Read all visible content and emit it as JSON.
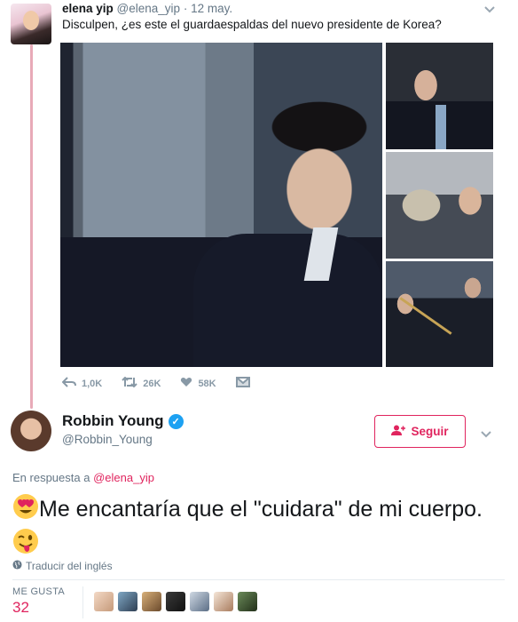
{
  "tweet1": {
    "display_name": "elena yip",
    "handle": "@elena_yip",
    "separator": "·",
    "date": "12 may.",
    "text": "Disculpen, ¿es este el guardaespaldas del nuevo presidente de Korea?",
    "actions": {
      "reply_count": "1,0K",
      "retweet_count": "26K",
      "like_count": "58K"
    },
    "icons": [
      "reply-icon",
      "retweet-icon",
      "heart-icon",
      "direct-message-icon",
      "chevron-down-icon"
    ]
  },
  "tweet2": {
    "display_name": "Robbin Young",
    "handle": "@Robbin_Young",
    "verified": true,
    "follow_label": "Seguir",
    "reply_prefix": "En respuesta a",
    "reply_to": "@elena_yip",
    "text_part1": "Me encantaría que el \"cuidara\" de mi cuerpo.",
    "translate_label": "Traducir del inglés",
    "likes_label": "ME GUSTA",
    "likes_count": "32",
    "likers_count": 7
  },
  "colors": {
    "accent": "#e0245e",
    "thread_line": "#e8aab8",
    "verified": "#1da1f2",
    "muted": "#657786"
  }
}
